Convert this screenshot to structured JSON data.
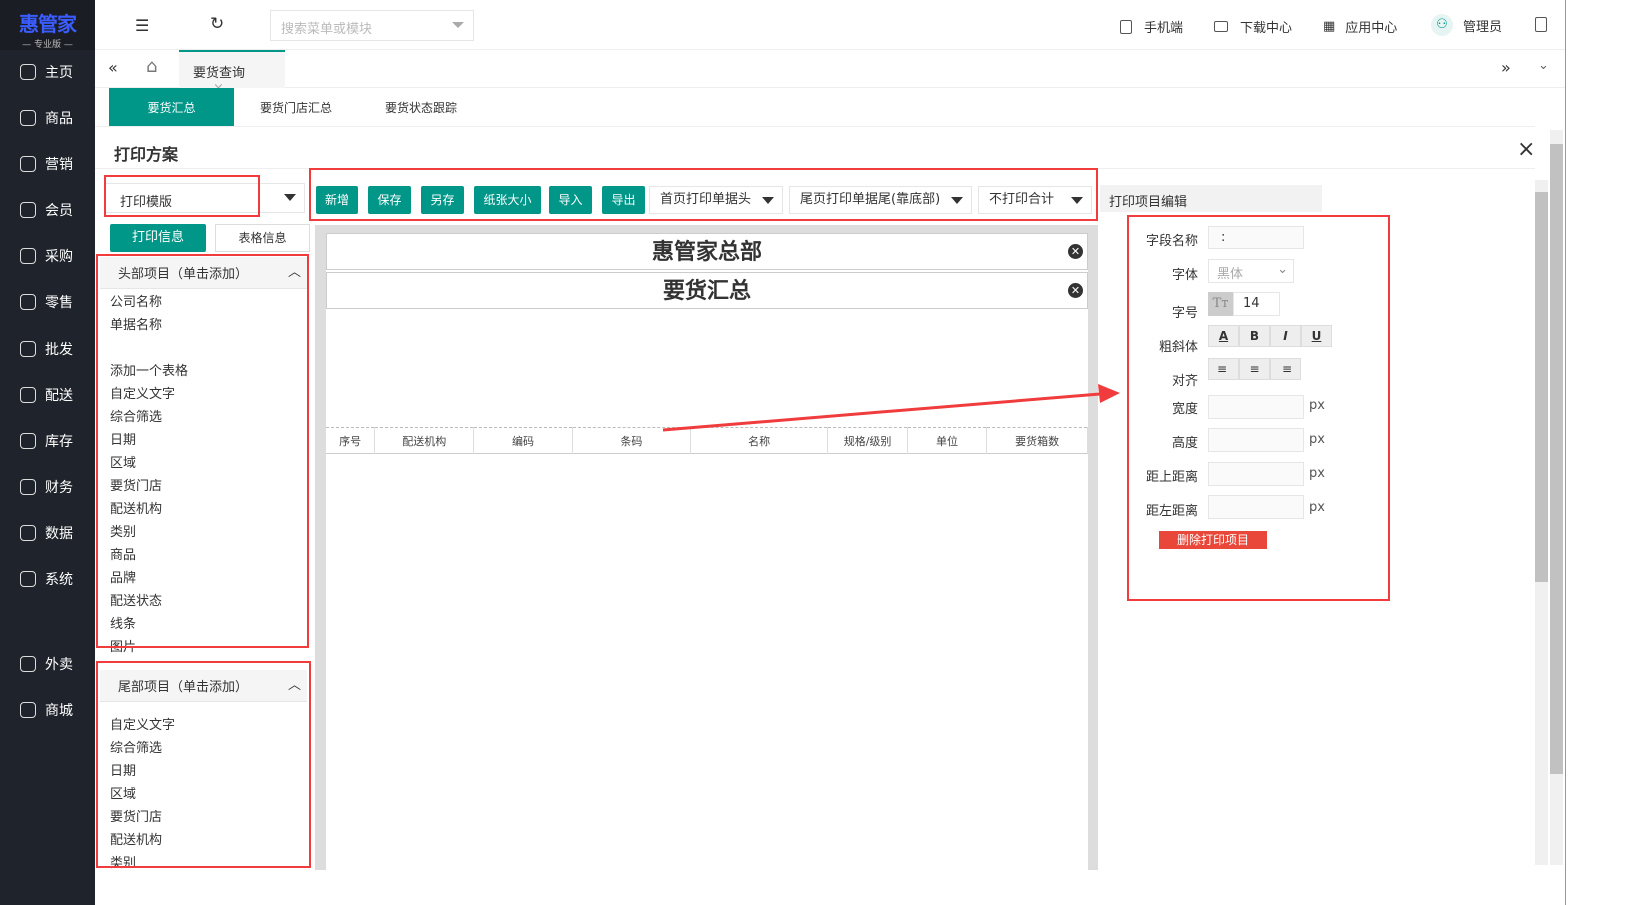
{
  "logo": {
    "title": "惠管家",
    "subtitle": "— 专业版 —"
  },
  "sidebar": {
    "items": [
      {
        "label": "主页"
      },
      {
        "label": "商品"
      },
      {
        "label": "营销"
      },
      {
        "label": "会员"
      },
      {
        "label": "采购"
      },
      {
        "label": "零售"
      },
      {
        "label": "批发"
      },
      {
        "label": "配送"
      },
      {
        "label": "库存"
      },
      {
        "label": "财务"
      },
      {
        "label": "数据"
      },
      {
        "label": "系统"
      },
      {
        "label": "外卖"
      },
      {
        "label": "商城"
      }
    ]
  },
  "topbar": {
    "search_placeholder": "搜索菜单或模块",
    "mobile": "手机端",
    "download": "下载中心",
    "apps": "应用中心",
    "user": "管理员"
  },
  "tabs": {
    "active": "要货查询"
  },
  "subtabs": [
    {
      "label": "要货汇总"
    },
    {
      "label": "要货门店汇总"
    },
    {
      "label": "要货状态跟踪"
    }
  ],
  "modal": {
    "title": "打印方案"
  },
  "left": {
    "template_select": "打印模版",
    "btn_print_info": "打印信息",
    "btn_table_info": "表格信息",
    "header_panel": {
      "title": "头部项目（单击添加）",
      "items": [
        "公司名称",
        "单据名称",
        "",
        "添加一个表格",
        "自定义文字",
        "综合筛选",
        "日期",
        "区域",
        "要货门店",
        "配送机构",
        "类别",
        "商品",
        "品牌",
        "配送状态",
        "线条",
        "图片"
      ]
    },
    "footer_panel": {
      "title": "尾部项目（单击添加）",
      "items": [
        "自定义文字",
        "综合筛选",
        "日期",
        "区域",
        "要货门店",
        "配送机构",
        "类别"
      ]
    }
  },
  "toolbar": {
    "buttons": [
      "新增",
      "保存",
      "另存",
      "纸张大小",
      "导入",
      "导出"
    ],
    "dropdowns": [
      "首页打印单据头",
      "尾页打印单据尾(靠底部)",
      "不打印合计"
    ]
  },
  "canvas": {
    "company": "惠管家总部",
    "doc_title": "要货汇总",
    "columns": [
      "序号",
      "配送机构",
      "编码",
      "条码",
      "名称",
      "规格/级别",
      "单位",
      "要货箱数"
    ]
  },
  "editor": {
    "title": "打印项目编辑",
    "field_name_label": "字段名称",
    "field_name_value": ":",
    "font_label": "字体",
    "font_value": "黑体",
    "size_label": "字号",
    "size_value": "14",
    "style_label": "粗斜体",
    "style_buttons": [
      "A",
      "B",
      "I",
      "U"
    ],
    "align_label": "对齐",
    "width_label": "宽度",
    "height_label": "高度",
    "top_label": "距上距离",
    "left_label": "距左距离",
    "unit": "px",
    "delete_btn": "删除打印项目"
  },
  "colors": {
    "accent": "#009688",
    "sidebar": "#1f232b",
    "highlight": "#f03c3c"
  }
}
